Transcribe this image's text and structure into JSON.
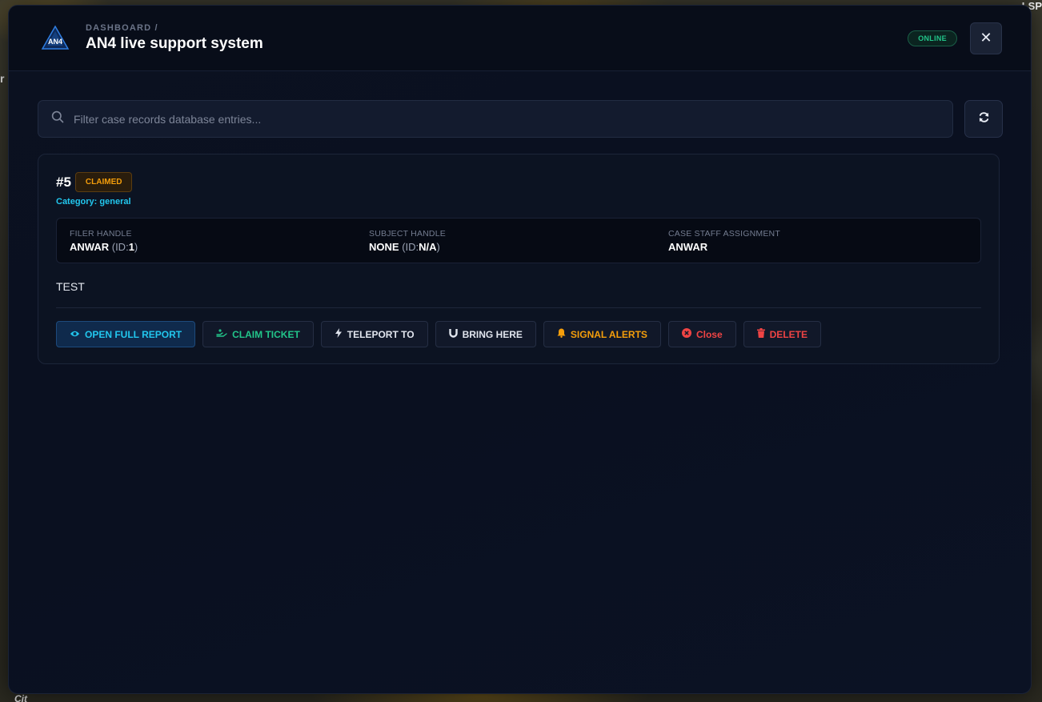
{
  "header": {
    "breadcrumb": "DASHBOARD /",
    "title": "AN4 live support system",
    "status": "ONLINE",
    "close_glyph": "✕",
    "logo_text": "AN4"
  },
  "search": {
    "placeholder": "Filter case records database entries...",
    "value": ""
  },
  "ticket": {
    "id": "#5",
    "status": "CLAIMED",
    "category_prefix": "Category:",
    "category": "general",
    "filer": {
      "label": "FILER HANDLE",
      "name": "ANWAR",
      "id_prefix": "(ID:",
      "id": "1",
      "id_suffix": ")"
    },
    "subject": {
      "label": "SUBJECT HANDLE",
      "name": "NONE",
      "id_prefix": "(ID:",
      "id": "N/A",
      "id_suffix": ")"
    },
    "staff": {
      "label": "CASE STAFF ASSIGNMENT",
      "name": "ANWAR"
    },
    "description": "TEST"
  },
  "actions": {
    "open_report": "OPEN FULL REPORT",
    "claim": "CLAIM TICKET",
    "teleport": "TELEPORT TO",
    "bring": "BRING HERE",
    "signal": "SIGNAL ALERTS",
    "close": "Close",
    "delete": "DELETE"
  },
  "background_text": {
    "left": "r",
    "right": "LSP",
    "bottom": "Cit"
  },
  "colors": {
    "accent_cyan": "#22c7ee",
    "online_green": "#22c58a",
    "claimed_orange": "#f59e0b",
    "danger_red": "#ef4444"
  }
}
